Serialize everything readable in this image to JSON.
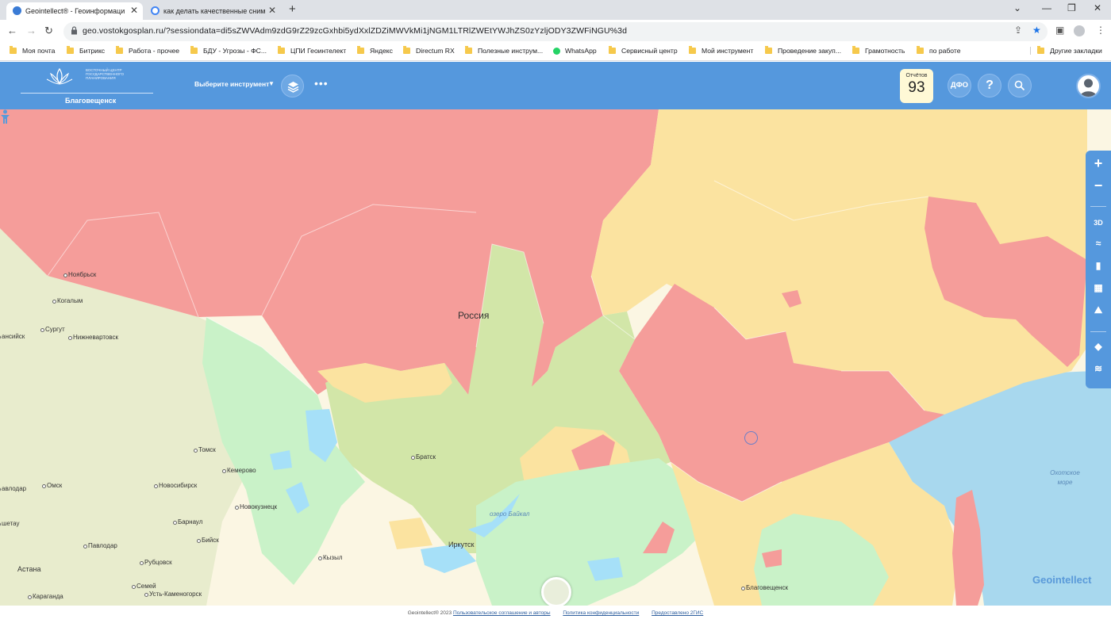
{
  "browser": {
    "tabs": [
      {
        "title": "Geointellect® - Геоинформаци",
        "active": true
      },
      {
        "title": "как делать качественные сним",
        "active": false
      }
    ],
    "new_tab_label": "+",
    "url": "geo.vostokgosplan.ru/?sessiondata=di5sZWVAdm9zdG9rZ29zcGxhbi5ydXxlZDZiMWVkMi1jNGM1LTRlZWEtYWJhZS0zYzljODY3ZWFiNGU%3d",
    "bookmarks": [
      {
        "label": "Моя почта",
        "icon": "folder-icon"
      },
      {
        "label": "Битрикс",
        "icon": "folder-icon"
      },
      {
        "label": "Работа - прочее",
        "icon": "folder-icon"
      },
      {
        "label": "БДУ - Угрозы - ФС...",
        "icon": "folder-icon"
      },
      {
        "label": "ЦПИ Геоинтелект",
        "icon": "folder-icon"
      },
      {
        "label": "Яндекс",
        "icon": "folder-icon"
      },
      {
        "label": "Directum RX",
        "icon": "folder-icon"
      },
      {
        "label": "Полезные инструм...",
        "icon": "folder-icon"
      },
      {
        "label": "WhatsApp",
        "icon": "whatsapp-icon"
      },
      {
        "label": "Сервисный центр",
        "icon": "folder-icon"
      },
      {
        "label": "Мой инструмент",
        "icon": "folder-icon"
      },
      {
        "label": "Проведение закуп...",
        "icon": "folder-icon"
      },
      {
        "label": "Грамотность",
        "icon": "folder-icon"
      },
      {
        "label": "по работе",
        "icon": "folder-icon"
      }
    ],
    "other_bookmarks": "Другие закладки"
  },
  "header": {
    "logo_text": "ВОСТОЧНЫЙ ЦЕНТР ГОСУДАРСТВЕННОГО ПЛАНИРОВАНИЯ",
    "city": "Благовещенск",
    "tool_select": "Выберите инструмент",
    "reports_label": "Отчётов",
    "reports_count": "93",
    "dfo_label": "ДФО",
    "help_label": "?",
    "accent": "#5598dd"
  },
  "map": {
    "country_label": "Россия",
    "cities": [
      {
        "name": "Ноябрьск"
      },
      {
        "name": "Когалым"
      },
      {
        "name": "Сургут"
      },
      {
        "name": "ансийск"
      },
      {
        "name": "Нижневартовск"
      },
      {
        "name": "Томск"
      },
      {
        "name": "Кемерово"
      },
      {
        "name": "Новосибирск"
      },
      {
        "name": "Омск"
      },
      {
        "name": "Новокузнецк"
      },
      {
        "name": "Барнаул"
      },
      {
        "name": "Бийск"
      },
      {
        "name": "Павлодар"
      },
      {
        "name": "Рубцовск"
      },
      {
        "name": "Семей"
      },
      {
        "name": "Усть-Каменогорск"
      },
      {
        "name": "Астана"
      },
      {
        "name": "Караганда"
      },
      {
        "name": "Кызыл"
      },
      {
        "name": "Иркутск"
      },
      {
        "name": "Братск"
      },
      {
        "name": "Благовещенск"
      },
      {
        "name": "авлодар"
      },
      {
        "name": "шетау"
      }
    ],
    "water_labels": [
      {
        "name": "Охотское море"
      },
      {
        "name": "озеро Байкал"
      }
    ],
    "region_colors": {
      "red": "#f59d9a",
      "yellow": "#fbe3a0",
      "light_green": "#d2e6a8",
      "mint": "#c9f2c8",
      "blue": "#a6e0f8",
      "sea": "#a8d8ee"
    }
  },
  "map_tools": {
    "zoom_in": "+",
    "zoom_out": "−",
    "three_d": "3D"
  },
  "brand": "Geointellect",
  "footer": {
    "copyright": "Geointellect® 2023",
    "links": [
      "Пользовательское соглашение и авторы",
      "Политика конфиденциальности",
      "Предоставлено 2ГИС"
    ]
  }
}
